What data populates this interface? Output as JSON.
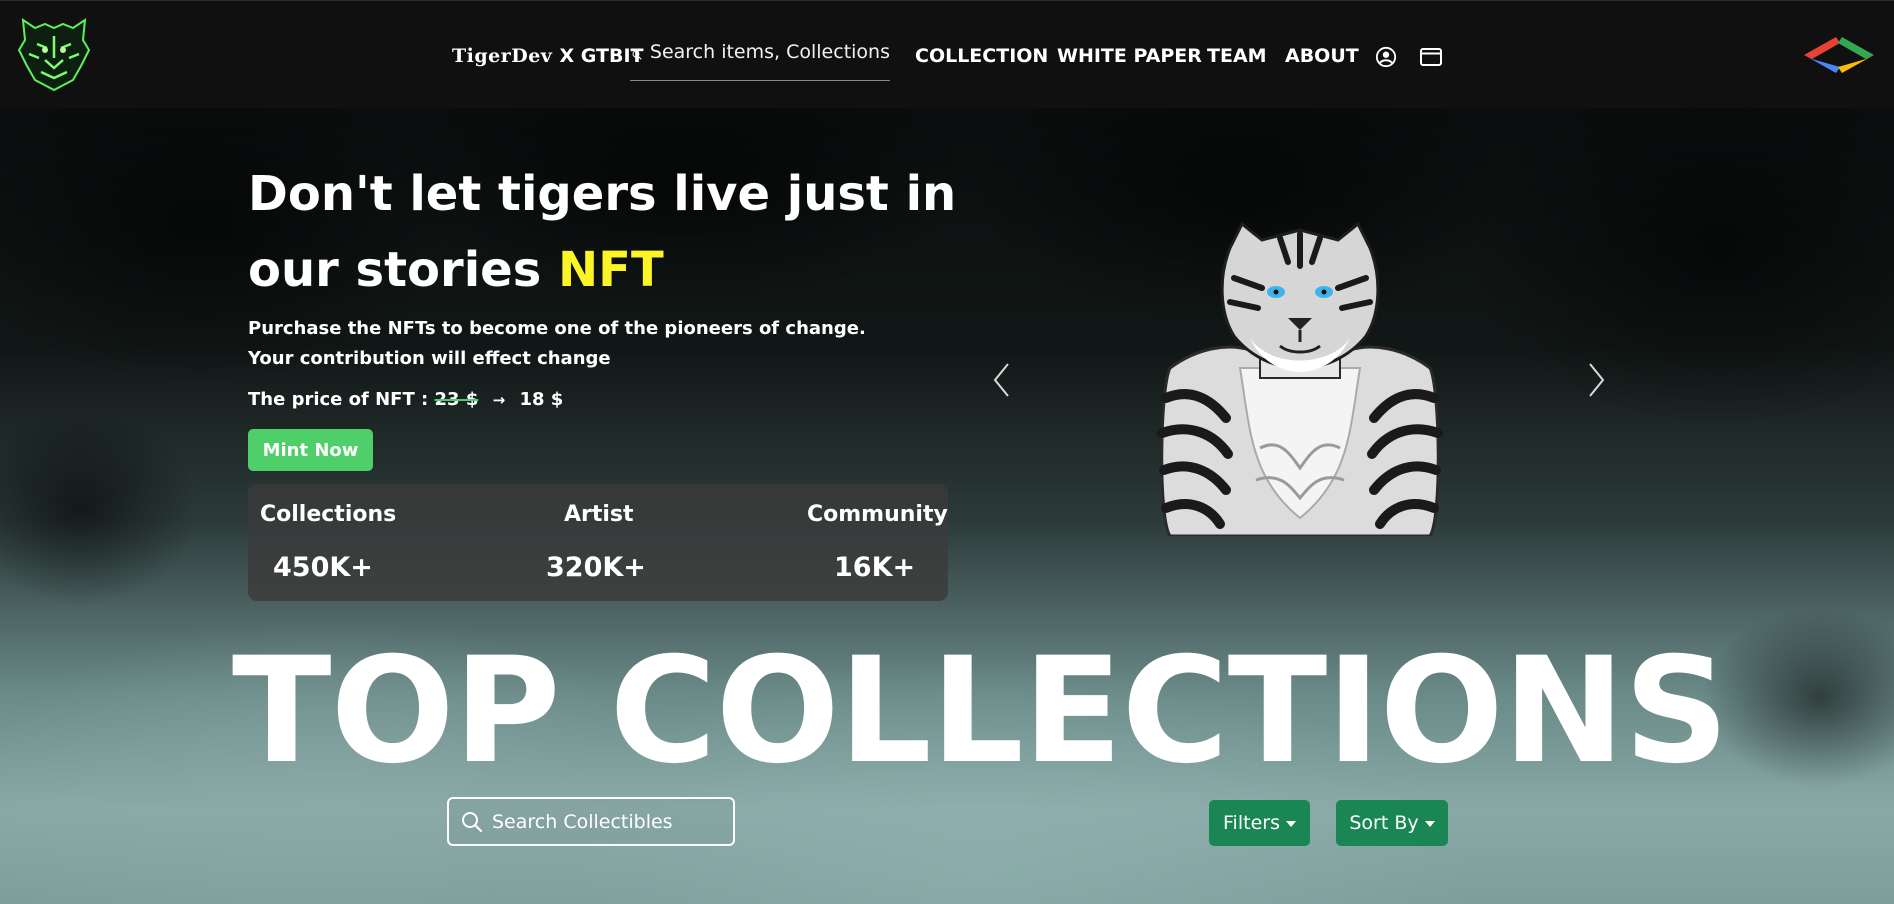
{
  "nav": {
    "brand_part1": "TigerDev",
    "brand_part2": "X GTBIT",
    "search_placeholder": "Search items, Collections",
    "links": [
      "COLLECTION",
      "WHITE PAPER",
      "TEAM",
      "ABOUT"
    ],
    "icons": [
      "logo-tiger",
      "search-icon",
      "user-icon",
      "wallet-icon",
      "brand-mark-icon"
    ]
  },
  "hero": {
    "title_main": "Don't let tigers live just in our stories",
    "title_accent": "NFT",
    "description": "Purchase the NFTs to become one of the pioneers of change. Your contribution will effect change",
    "price_label": "The price of NFT :",
    "price_old": "23 $",
    "price_arrow": "→",
    "price_new": "18 $",
    "mint_label": "Mint Now",
    "accent_color": "#fbf427",
    "mint_color": "#4fcf6a"
  },
  "stats": [
    {
      "label": "Collections",
      "value": "450K+"
    },
    {
      "label": "Artist",
      "value": "320K+"
    },
    {
      "label": "Community",
      "value": "16K+"
    }
  ],
  "collections": {
    "title": "TOP COLLECTIONS",
    "search_placeholder": "Search Collectibles",
    "filters_label": "Filters",
    "sort_label": "Sort By",
    "button_color": "#198654"
  }
}
